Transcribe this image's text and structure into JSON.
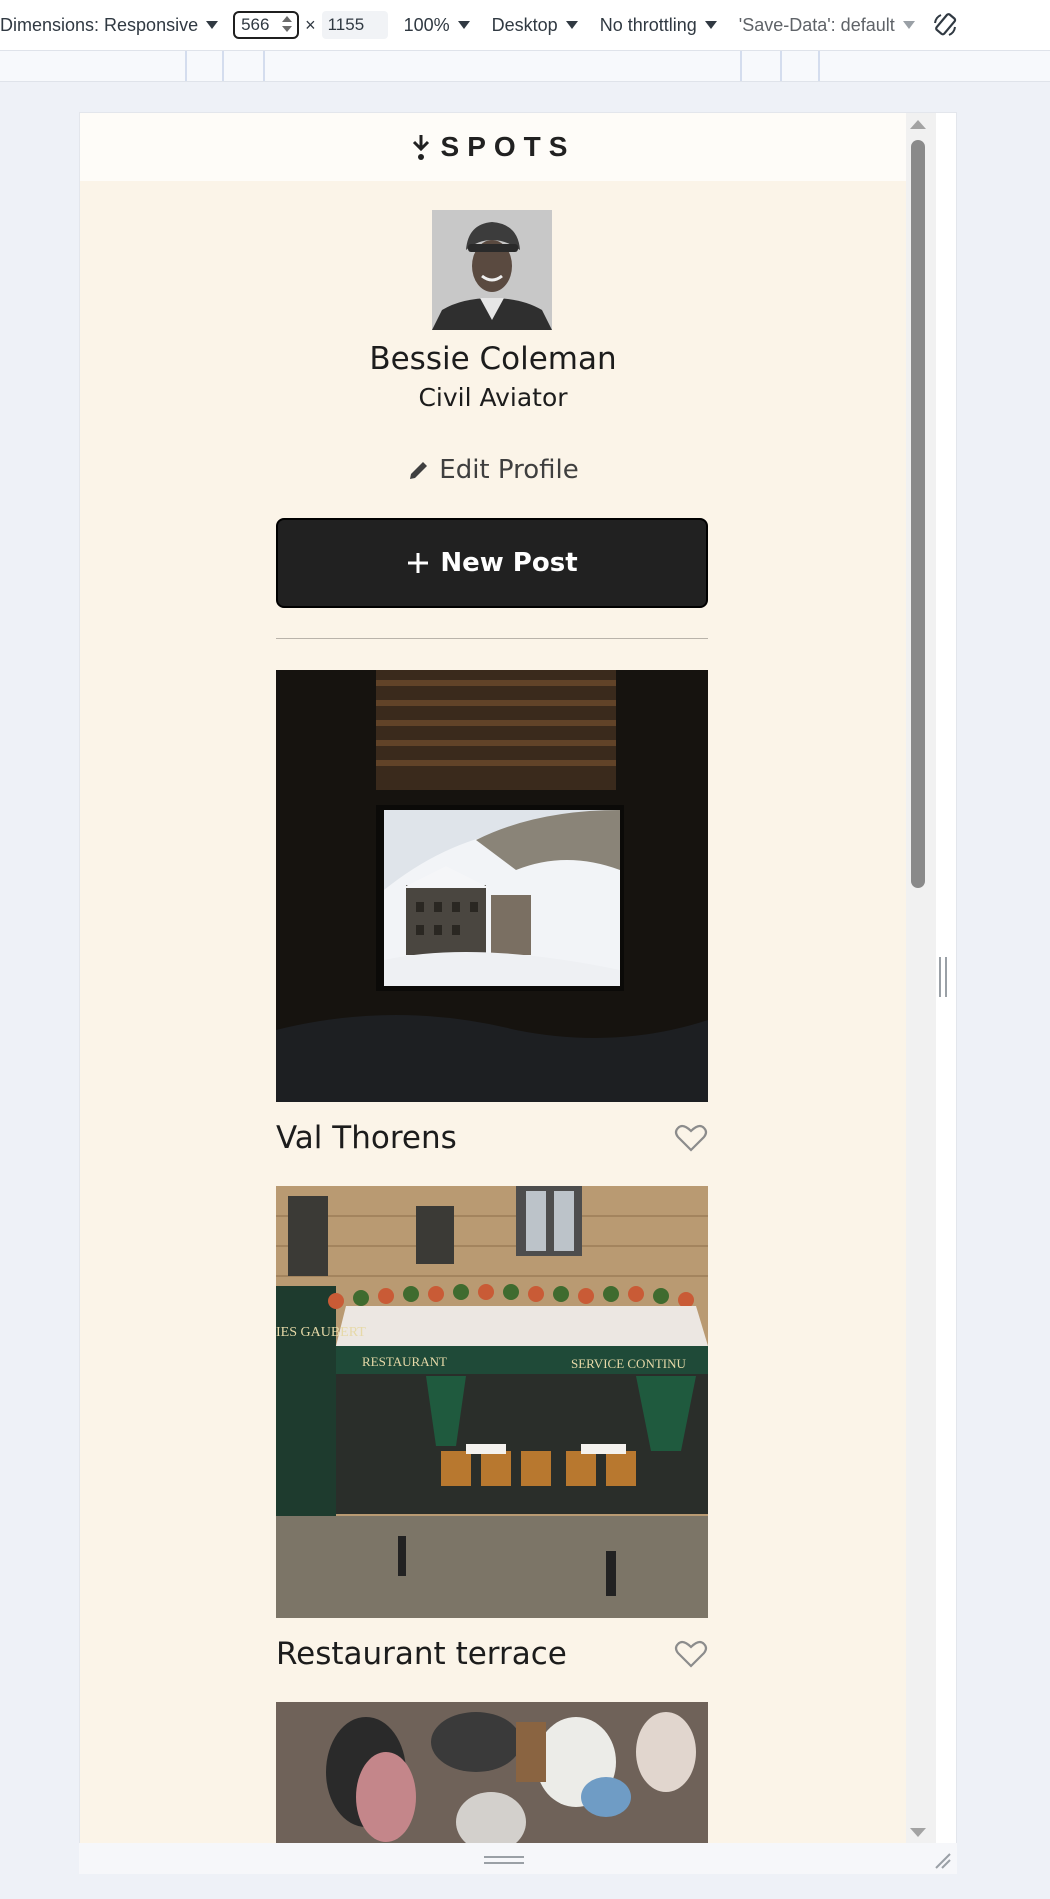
{
  "devtools": {
    "dimensions_label": "Dimensions: Responsive",
    "width_value": "566",
    "times": "×",
    "height_value": "1155",
    "zoom": "100%",
    "device": "Desktop",
    "throttling": "No throttling",
    "save_data": "'Save-Data': default"
  },
  "app": {
    "logo_text": "SPOTS",
    "profile": {
      "name": "Bessie Coleman",
      "title": "Civil Aviator",
      "edit_label": "Edit Profile"
    },
    "new_post_label": "New Post",
    "cards": [
      {
        "title": "Val Thorens",
        "liked": false
      },
      {
        "title": "Restaurant terrace",
        "liked": false
      },
      {
        "title": "",
        "liked": false
      }
    ],
    "restaurant_sign": {
      "left": "RESTAURANT",
      "right": "SERVICE CONTINU",
      "side": "IES GAUBERT"
    }
  },
  "colors": {
    "page_bg": "#fbf4e8",
    "header_bg": "#fefcf8",
    "button_bg": "#212121",
    "text": "#1c1c1c"
  }
}
